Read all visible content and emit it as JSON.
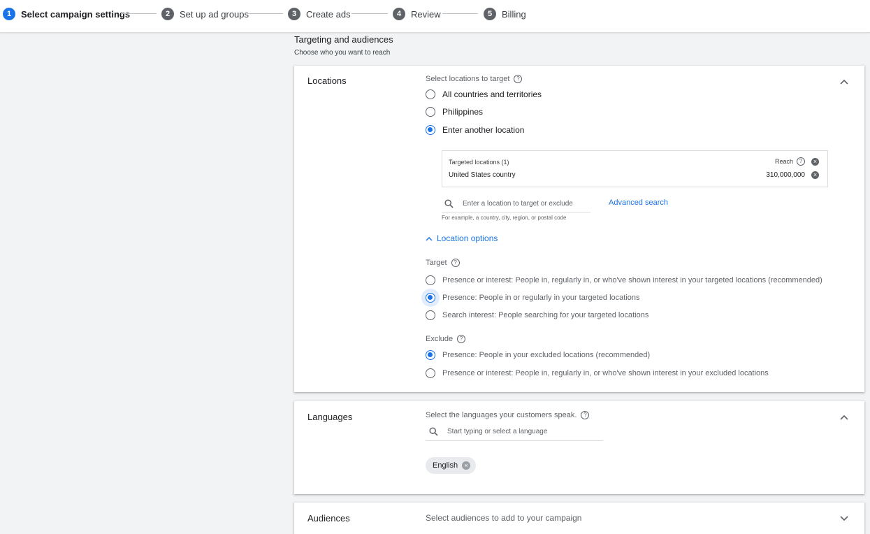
{
  "stepper": {
    "steps": [
      {
        "num": "1",
        "label": "Select campaign settings"
      },
      {
        "num": "2",
        "label": "Set up ad groups"
      },
      {
        "num": "3",
        "label": "Create ads"
      },
      {
        "num": "4",
        "label": "Review"
      },
      {
        "num": "5",
        "label": "Billing"
      }
    ]
  },
  "section": {
    "title": "Targeting and audiences",
    "subtitle": "Choose who you want to reach"
  },
  "locations": {
    "name": "Locations",
    "prompt": "Select locations to target",
    "options": [
      {
        "label": "All countries and territories",
        "selected": false
      },
      {
        "label": "Philippines",
        "selected": false
      },
      {
        "label": "Enter another location",
        "selected": true
      }
    ],
    "targeted": {
      "header": "Targeted locations (1)",
      "reach_label": "Reach",
      "location": "United States country",
      "reach_value": "310,000,000"
    },
    "search_placeholder": "Enter a location to target or exclude",
    "search_hint": "For example, a country, city, region, or postal code",
    "advanced_search": "Advanced search",
    "location_options": "Location options",
    "target_label": "Target",
    "target_options": [
      {
        "label": "Presence or interest: People in, regularly in, or who've shown interest in your targeted locations (recommended)",
        "selected": false
      },
      {
        "label": "Presence: People in or regularly in your targeted locations",
        "selected": true
      },
      {
        "label": "Search interest: People searching for your targeted locations",
        "selected": false
      }
    ],
    "exclude_label": "Exclude",
    "exclude_options": [
      {
        "label": "Presence: People in your excluded locations (recommended)",
        "selected": true
      },
      {
        "label": "Presence or interest: People in, regularly in, or who've shown interest in your excluded locations",
        "selected": false
      }
    ]
  },
  "languages": {
    "name": "Languages",
    "prompt": "Select the languages your customers speak.",
    "search_placeholder": "Start typing or select a language",
    "chip": "English"
  },
  "audiences": {
    "name": "Audiences",
    "prompt": "Select audiences to add to your campaign"
  },
  "colors": {
    "accent": "#1a73e8",
    "page_bg": "#f1f3f4"
  }
}
